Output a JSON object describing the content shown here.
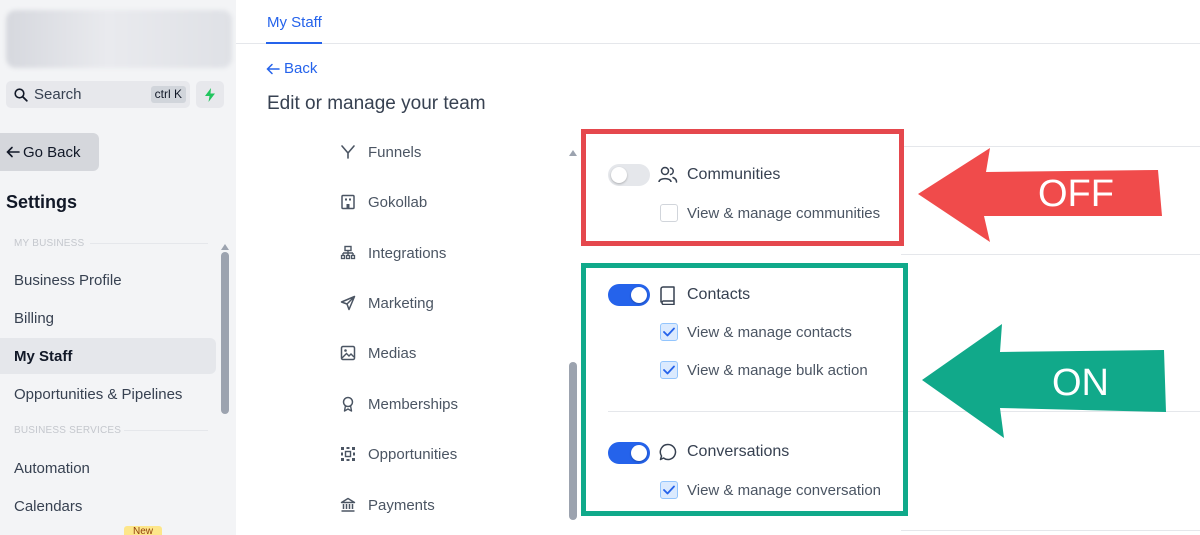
{
  "sidebar": {
    "search_label": "Search",
    "search_shortcut": "ctrl K",
    "go_back": "Go Back",
    "settings_title": "Settings",
    "section_my_business": "MY BUSINESS",
    "section_business_services": "BUSINESS SERVICES",
    "items": [
      "Business Profile",
      "Billing",
      "My Staff",
      "Opportunities & Pipelines",
      "Automation",
      "Calendars"
    ],
    "active_item": "My Staff",
    "new_badge": "New"
  },
  "header": {
    "tab": "My Staff",
    "back": "Back",
    "page_title": "Edit or manage your team"
  },
  "menu": {
    "items": [
      {
        "label": "Funnels",
        "icon": "funnel-icon"
      },
      {
        "label": "Gokollab",
        "icon": "building-icon"
      },
      {
        "label": "Integrations",
        "icon": "integrations-icon"
      },
      {
        "label": "Marketing",
        "icon": "send-icon"
      },
      {
        "label": "Medias",
        "icon": "image-icon"
      },
      {
        "label": "Memberships",
        "icon": "badge-icon"
      },
      {
        "label": "Opportunities",
        "icon": "opportunities-icon"
      },
      {
        "label": "Payments",
        "icon": "bank-icon"
      }
    ]
  },
  "permissions": {
    "communities": {
      "title": "Communities",
      "enabled": false,
      "options": [
        {
          "label": "View & manage communities",
          "checked": false
        }
      ]
    },
    "contacts": {
      "title": "Contacts",
      "enabled": true,
      "options": [
        {
          "label": "View & manage contacts",
          "checked": true
        },
        {
          "label": "View & manage bulk action",
          "checked": true
        }
      ]
    },
    "conversations": {
      "title": "Conversations",
      "enabled": true,
      "options": [
        {
          "label": "View & manage conversation",
          "checked": true
        }
      ]
    }
  },
  "annotations": {
    "off_label": "OFF",
    "on_label": "ON",
    "off_color": "#f04b4b",
    "on_color": "#11a98a"
  },
  "colors": {
    "accent": "#2563eb",
    "sidebar_bg": "#f3f4f6"
  }
}
